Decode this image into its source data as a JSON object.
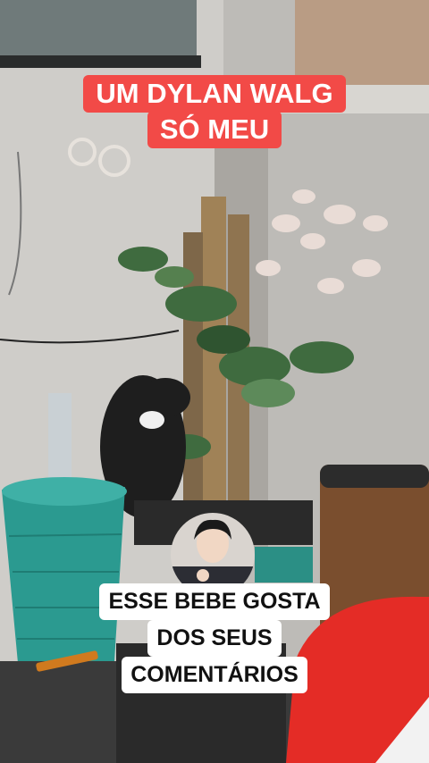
{
  "top_caption": {
    "line1": "UM DYLAN WALG",
    "line2": "SÓ MEU"
  },
  "bottom_caption": {
    "line1": "ESSE BEBE GOSTA",
    "line2": "DOS SEUS",
    "line3": "COMENTÁRIOS"
  },
  "colors": {
    "top_caption_bg": "#f24a47",
    "bottom_caption_bg": "#ffffff"
  }
}
